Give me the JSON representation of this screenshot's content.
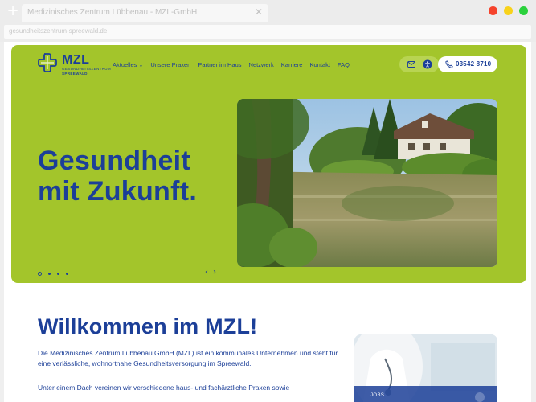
{
  "browser": {
    "tab_title": "Medizinisches Zentrum Lübbenau - MZL-GmbH",
    "url": "gesundheitszentrum-spreewald.de"
  },
  "logo": {
    "name": "MZL",
    "line1": "GESUNDHEITSZENTRUM",
    "line2": "SPREEWALD"
  },
  "nav": {
    "items": [
      {
        "label": "Aktuelles",
        "has_dropdown": true
      },
      {
        "label": "Unsere Praxen"
      },
      {
        "label": "Partner im Haus"
      },
      {
        "label": "Netzwerk"
      },
      {
        "label": "Karriere"
      },
      {
        "label": "Kontakt"
      },
      {
        "label": "FAQ"
      }
    ],
    "phone": "03542 8710",
    "mail_icon": "mail-icon",
    "accessibility_icon": "accessibility-icon",
    "phone_icon": "phone-icon"
  },
  "hero": {
    "line1": "Gesundheit",
    "line2": "mit Zukunft.",
    "slide_count": 4,
    "active_slide": 1,
    "prev_arrow": "‹",
    "next_arrow": "›"
  },
  "welcome": {
    "title": "Willkommen im MZL!",
    "paragraph1": "Die Medizinisches Zentrum Lübbenau GmbH (MZL) ist ein kommunales Unternehmen und steht für eine verlässliche, wohnortnahe Gesundheitsversorgung im Spreewald.",
    "paragraph2": "Unter einem Dach vereinen wir verschiedene haus- und fachärztliche Praxen sowie"
  },
  "job_card": {
    "label": "JOBS"
  },
  "colors": {
    "brand_blue": "#1c3f98",
    "hero_green": "#a3c52b",
    "pill_green": "#b8d452"
  }
}
